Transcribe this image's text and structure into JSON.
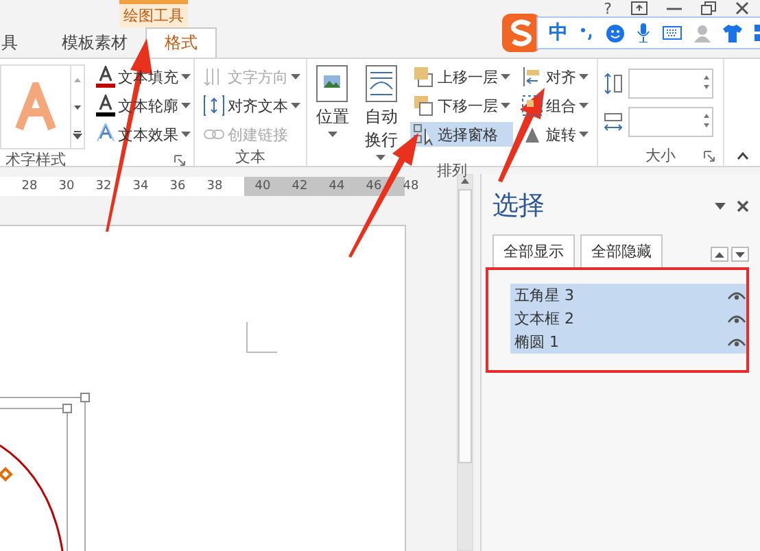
{
  "contextual_tab": {
    "label": "绘图工具"
  },
  "window_controls": {
    "help": "?"
  },
  "tabs": [
    {
      "label": "具",
      "selected": false
    },
    {
      "label": "模板素材",
      "selected": false
    },
    {
      "label": "格式",
      "selected": true
    }
  ],
  "ime_toolbar": {
    "mode": "中"
  },
  "ribbon": {
    "art_styles": {
      "label": "术字样式"
    },
    "text_effects": [
      {
        "label": "文本填充"
      },
      {
        "label": "文本轮廓"
      },
      {
        "label": "文本效果"
      }
    ],
    "text_group": {
      "label": "文本",
      "items": [
        {
          "label": "文字方向",
          "disabled": true
        },
        {
          "label": "对齐文本",
          "disabled": false
        },
        {
          "label": "创建链接",
          "disabled": true
        }
      ]
    },
    "arrange_group": {
      "label": "排列",
      "large_buttons": [
        {
          "label": "位置"
        },
        {
          "label": "自动换行"
        }
      ],
      "layer_items": [
        {
          "label": "上移一层",
          "selected": false
        },
        {
          "label": "下移一层",
          "selected": false
        },
        {
          "label": "选择窗格",
          "selected": true
        }
      ],
      "align_items": [
        {
          "label": "对齐"
        },
        {
          "label": "组合"
        },
        {
          "label": "旋转"
        }
      ]
    },
    "size_group": {
      "label": "大小"
    }
  },
  "ruler": {
    "ticks": [
      "28",
      "30",
      "32",
      "34",
      "36",
      "38",
      "40",
      "42",
      "44",
      "46",
      "48"
    ]
  },
  "selection_pane": {
    "title": "选择",
    "buttons": [
      "全部显示",
      "全部隐藏"
    ],
    "items": [
      {
        "label": "五角星 3",
        "selected": true,
        "visible": true
      },
      {
        "label": "文本框 2",
        "selected": true,
        "visible": true
      },
      {
        "label": "椭圆 1",
        "selected": true,
        "visible": true
      }
    ]
  }
}
